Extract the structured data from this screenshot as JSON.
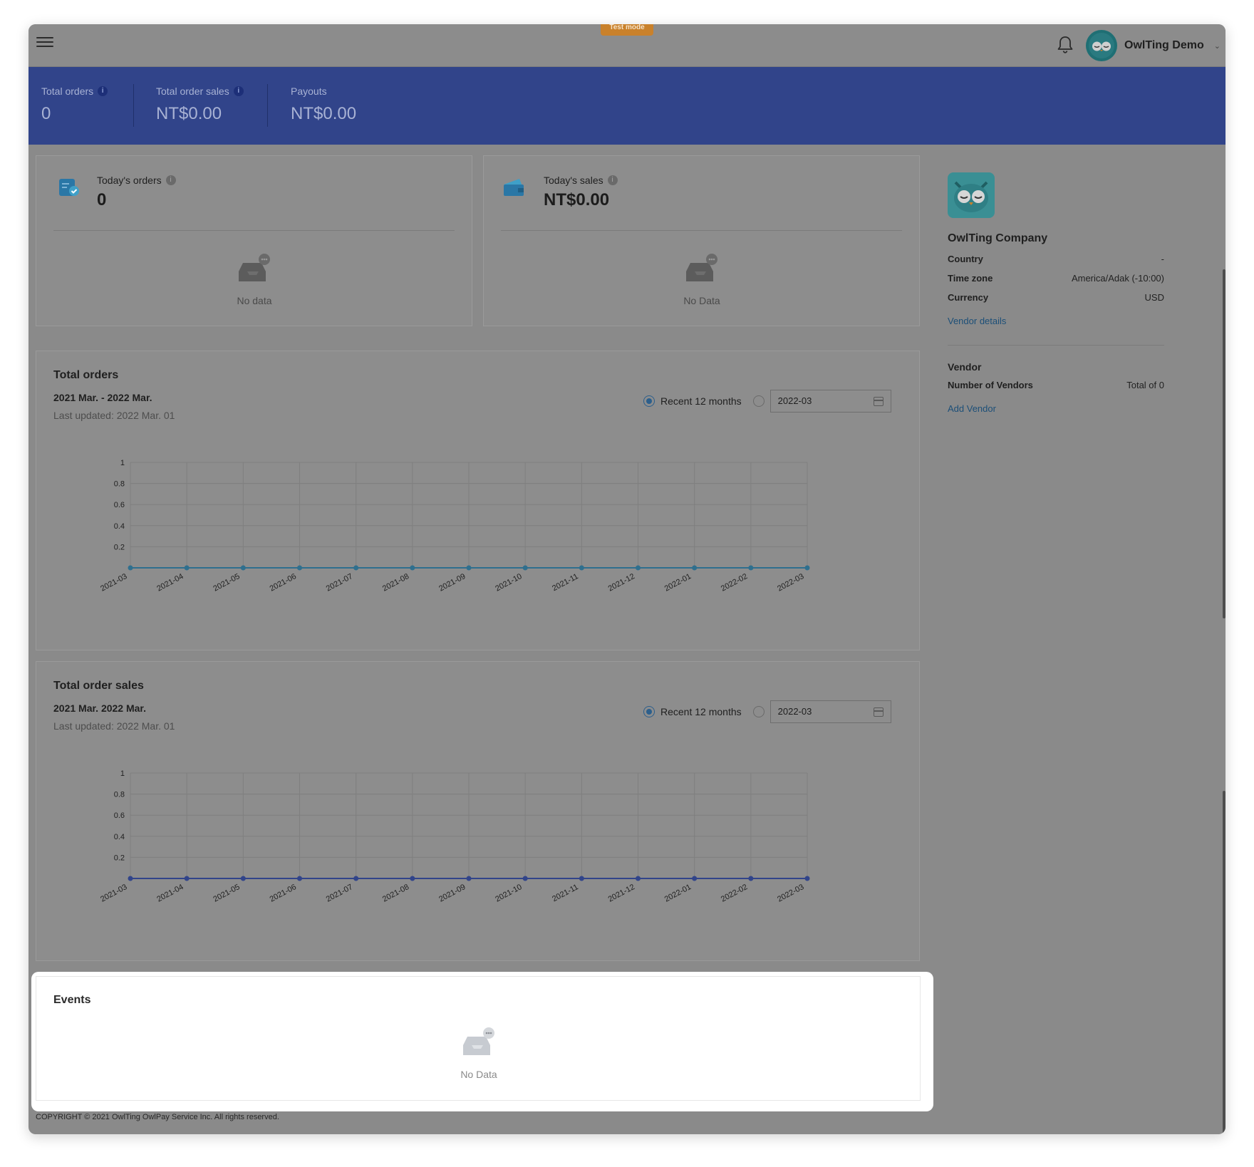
{
  "topbar": {
    "test_mode_label": "Test mode",
    "user_name": "OwlTing Demo"
  },
  "stats": [
    {
      "label": "Total orders",
      "value": "0",
      "has_info": true
    },
    {
      "label": "Total order sales",
      "value": "NT$0.00",
      "has_info": true
    },
    {
      "label": "Payouts",
      "value": "NT$0.00",
      "has_info": false
    }
  ],
  "today_orders": {
    "label": "Today's orders",
    "value": "0",
    "empty_text": "No data"
  },
  "today_sales": {
    "label": "Today's sales",
    "value": "NT$0.00",
    "empty_text": "No Data"
  },
  "orders_chart": {
    "title": "Total orders",
    "range": "2021 Mar. - 2022 Mar.",
    "updated": "Last updated: 2022 Mar. 01",
    "radio_label": "Recent 12 months",
    "date_value": "2022-03"
  },
  "sales_chart": {
    "title": "Total order sales",
    "range": "2021 Mar. 2022 Mar.",
    "updated": "Last updated: 2022 Mar. 01",
    "radio_label": "Recent 12 months",
    "date_value": "2022-03"
  },
  "chart_data": [
    {
      "type": "line",
      "x": [
        "2021-03",
        "2021-04",
        "2021-05",
        "2021-06",
        "2021-07",
        "2021-08",
        "2021-09",
        "2021-10",
        "2021-11",
        "2021-12",
        "2022-01",
        "2022-02",
        "2022-03"
      ],
      "values": [
        0,
        0,
        0,
        0,
        0,
        0,
        0,
        0,
        0,
        0,
        0,
        0,
        0
      ],
      "yticks": [
        "0.2",
        "0.4",
        "0.6",
        "0.8",
        "1"
      ],
      "ylim": [
        0,
        1
      ],
      "grid": true,
      "color": "#2f6f8e"
    },
    {
      "type": "line",
      "x": [
        "2021-03",
        "2021-04",
        "2021-05",
        "2021-06",
        "2021-07",
        "2021-08",
        "2021-09",
        "2021-10",
        "2021-11",
        "2021-12",
        "2022-01",
        "2022-02",
        "2022-03"
      ],
      "values": [
        0,
        0,
        0,
        0,
        0,
        0,
        0,
        0,
        0,
        0,
        0,
        0,
        0
      ],
      "yticks": [
        "0.2",
        "0.4",
        "0.6",
        "0.8",
        "1"
      ],
      "ylim": [
        0,
        1
      ],
      "grid": true,
      "color": "#31448a"
    }
  ],
  "side": {
    "company": "OwlTing Company",
    "rows": [
      {
        "key": "Country",
        "value": "-"
      },
      {
        "key": "Time zone",
        "value": "America/Adak (-10:00)"
      },
      {
        "key": "Currency",
        "value": "USD"
      }
    ],
    "vendor_details_link": "Vendor details",
    "vendor_heading": "Vendor",
    "vendor_count_key": "Number of Vendors",
    "vendor_count_value": "Total of 0",
    "add_vendor_link": "Add Vendor"
  },
  "events": {
    "title": "Events",
    "empty_text": "No Data"
  },
  "footer": {
    "copyright": "COPYRIGHT © 2021 OwlTing OwlPay Service Inc. All rights reserved."
  },
  "colors": {
    "accent_blue": "#31448a",
    "test_mode": "#c9812b",
    "link": "#1c4f78"
  }
}
